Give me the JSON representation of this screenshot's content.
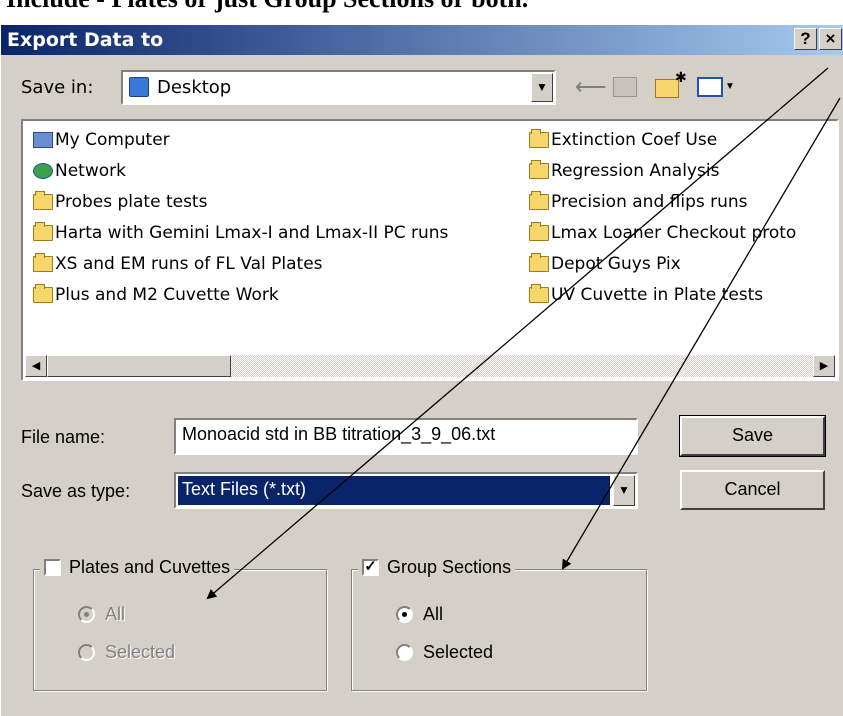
{
  "page_heading": "Include - Plates or just Group Sections or both.",
  "dialog": {
    "title": "Export Data to",
    "help_label": "?",
    "close_label": "×",
    "save_in_label": "Save in:",
    "save_in_value": "Desktop",
    "files": [
      {
        "name": "My Computer",
        "icon": "computer-icon"
      },
      {
        "name": "Network",
        "icon": "network-icon"
      },
      {
        "name": "Probes plate tests",
        "icon": "folder-icon"
      },
      {
        "name": "Harta with Gemini Lmax-I and Lmax-II PC runs",
        "icon": "folder-icon"
      },
      {
        "name": "XS and EM runs of FL Val Plates",
        "icon": "folder-icon"
      },
      {
        "name": "Plus and M2 Cuvette  Work",
        "icon": "folder-icon"
      },
      {
        "name": "Extinction Coef Use",
        "icon": "folder-icon"
      },
      {
        "name": "Regression Analysis",
        "icon": "folder-icon"
      },
      {
        "name": "Precision and flips runs",
        "icon": "folder-icon"
      },
      {
        "name": "Lmax Loaner Checkout proto",
        "icon": "folder-icon"
      },
      {
        "name": "Depot Guys Pix",
        "icon": "folder-icon"
      },
      {
        "name": "UV Cuvette in Plate tests",
        "icon": "folder-icon"
      }
    ],
    "file_name_label": "File name:",
    "file_name_value": "Monoacid std in BB titration_3_9_06.txt",
    "save_type_label": "Save as type:",
    "save_type_value": "Text Files (*.txt)",
    "save_button": "Save",
    "cancel_button": "Cancel",
    "plates_group": {
      "label": "Plates and Cuvettes",
      "checked": false,
      "options": [
        "All",
        "Selected"
      ],
      "selected": "All"
    },
    "sections_group": {
      "label": "Group Sections",
      "checked": true,
      "options": [
        "All",
        "Selected"
      ],
      "selected": "All"
    }
  },
  "colors": {
    "title_gradient_start": "#0a246a",
    "title_gradient_end": "#a6caf0",
    "dialog_face": "#d4d0c8",
    "selection": "#0a246a"
  }
}
